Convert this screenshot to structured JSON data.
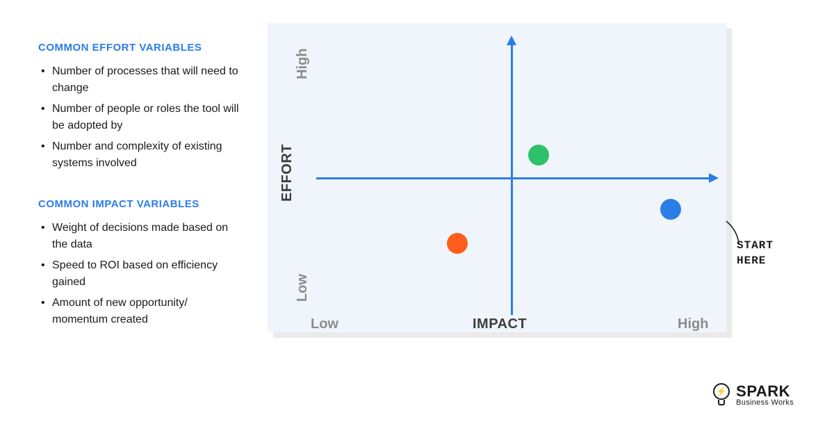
{
  "left": {
    "effort_title": "COMMON EFFORT VARIABLES",
    "effort_items": [
      "Number of processes that will need to change",
      "Number of people or roles the tool will be adopted by",
      "Number and complexity of existing systems involved"
    ],
    "impact_title": "COMMON IMPACT VARIABLES",
    "impact_items": [
      "Weight of decisions made based on the data",
      "Speed to ROI based on efficiency gained",
      "Amount of new opportunity/ momentum created"
    ]
  },
  "chart": {
    "x_label": "IMPACT",
    "y_label": "EFFORT",
    "low": "Low",
    "high": "High"
  },
  "callout": {
    "line1": "START",
    "line2": "HERE"
  },
  "logo": {
    "main": "SPARK",
    "sub": "Business Works"
  },
  "chart_data": {
    "type": "scatter",
    "title": "Effort vs Impact Prioritization Matrix",
    "xlabel": "IMPACT",
    "ylabel": "EFFORT",
    "xlim": [
      0,
      100
    ],
    "ylim": [
      0,
      100
    ],
    "x_ticks": [
      "Low",
      "High"
    ],
    "y_ticks": [
      "Low",
      "High"
    ],
    "series": [
      {
        "name": "green",
        "color": "#2fc06a",
        "x": 55,
        "y": 57
      },
      {
        "name": "orange",
        "color": "#ff5d1c",
        "x": 40,
        "y": 26
      },
      {
        "name": "blue",
        "color": "#2b7de9",
        "x": 85,
        "y": 40,
        "annotation": "START HERE"
      }
    ]
  }
}
